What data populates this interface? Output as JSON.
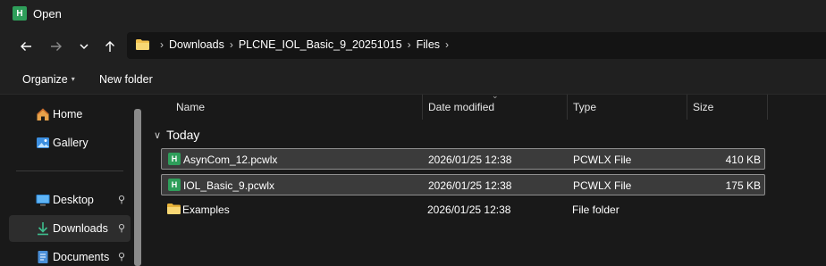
{
  "window": {
    "title": "Open",
    "app_icon_letter": "H",
    "accent": "#2e9e5a"
  },
  "nav": {
    "back_icon": "arrow-left-icon",
    "forward_icon": "arrow-right-icon",
    "recent_icon": "chevron-down-icon",
    "up_icon": "arrow-up-icon"
  },
  "address": {
    "crumbs": [
      "Downloads",
      "PLCNE_IOL_Basic_9_20251015",
      "Files"
    ]
  },
  "commands": {
    "organize": "Organize",
    "organize_caret": "▾",
    "new_folder": "New folder"
  },
  "sidebar": {
    "items": [
      {
        "label": "Home",
        "icon": "home-icon",
        "pinned": false
      },
      {
        "label": "Gallery",
        "icon": "gallery-icon",
        "pinned": false
      },
      {
        "label": "Desktop",
        "icon": "desktop-icon",
        "pinned": true
      },
      {
        "label": "Downloads",
        "icon": "downloads-icon",
        "pinned": true,
        "active": true
      },
      {
        "label": "Documents",
        "icon": "documents-icon",
        "pinned": true
      }
    ],
    "pin_glyph": "📌"
  },
  "columns": {
    "name": "Name",
    "date": "Date modified",
    "type": "Type",
    "size": "Size",
    "sort_glyph": "⌄"
  },
  "group": {
    "label": "Today",
    "chevron": "∨"
  },
  "files": [
    {
      "name": "AsynCom_12.pcwlx",
      "date": "2026/01/25 12:38",
      "type": "PCWLX File",
      "size": "410 KB",
      "kind": "pcwlx",
      "selected": true
    },
    {
      "name": "IOL_Basic_9.pcwlx",
      "date": "2026/01/25 12:38",
      "type": "PCWLX File",
      "size": "175 KB",
      "kind": "pcwlx",
      "selected": true
    },
    {
      "name": "Examples",
      "date": "2026/01/25 12:38",
      "type": "File folder",
      "size": "",
      "kind": "folder",
      "selected": false
    }
  ]
}
